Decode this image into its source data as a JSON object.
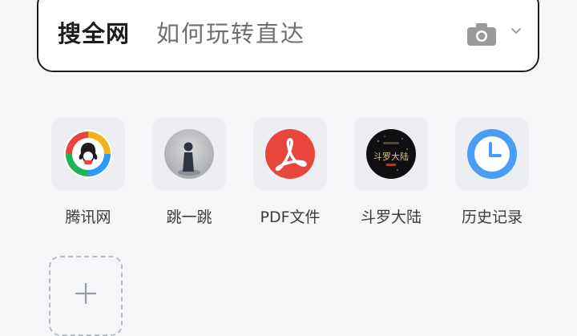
{
  "search": {
    "scope_label": "搜全网",
    "query": "如何玩转直达",
    "camera_icon": "camera-icon",
    "dropdown_icon": "chevron-down-icon"
  },
  "shortcuts": [
    {
      "label": "腾讯网",
      "icon": "tencent-news-logo"
    },
    {
      "label": "跳一跳",
      "icon": "jump-game-icon"
    },
    {
      "label": "PDF文件",
      "icon": "pdf-icon"
    },
    {
      "label": "斗罗大陆",
      "icon": "douluo-dalu-icon",
      "icon_text": "斗罗大陆"
    },
    {
      "label": "历史记录",
      "icon": "clock-icon"
    }
  ],
  "add_tile": {
    "icon": "plus-icon"
  },
  "colors": {
    "background": "#f5f6f8",
    "search_border": "#1c1c1c",
    "pdf_red": "#e8463d",
    "clock_blue": "#4a9df4"
  }
}
